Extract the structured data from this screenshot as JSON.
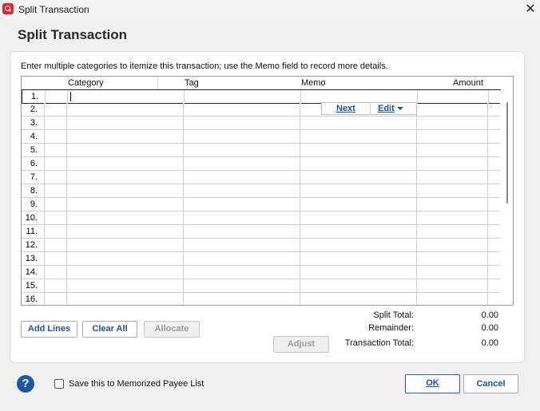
{
  "window": {
    "title": "Split Transaction",
    "close_glyph": "✕"
  },
  "heading": "Split Transaction",
  "instructions": "Enter multiple categories to itemize this transaction; use the Memo field to record more details.",
  "columns": {
    "category": "Category",
    "tag": "Tag",
    "memo": "Memo",
    "amount": "Amount"
  },
  "rows": [
    "1.",
    "2.",
    "3.",
    "4.",
    "5.",
    "6.",
    "7.",
    "8.",
    "9.",
    "10.",
    "11.",
    "12.",
    "13.",
    "14.",
    "15.",
    "16."
  ],
  "inline_buttons": {
    "next": "Next",
    "edit": "Edit"
  },
  "buttons": {
    "add_lines": "Add Lines",
    "clear_all": "Clear All",
    "allocate": "Allocate",
    "adjust": "Adjust"
  },
  "totals": {
    "split_total_label": "Split Total:",
    "split_total": "0.00",
    "remainder_label": "Remainder:",
    "remainder": "0.00",
    "transaction_total_label": "Transaction Total:",
    "transaction_total": "0.00"
  },
  "footer": {
    "help_glyph": "?",
    "memorize_label": "Save this to Memorized Payee List",
    "memorize_checked": false,
    "ok": "OK",
    "cancel": "Cancel"
  },
  "icons": [
    "quicken-app-icon",
    "close-icon",
    "help-icon",
    "chevron-down-icon"
  ],
  "colors": {
    "accent": "#1f4fa3",
    "brand": "#e3262e",
    "help": "#1e55a8"
  }
}
